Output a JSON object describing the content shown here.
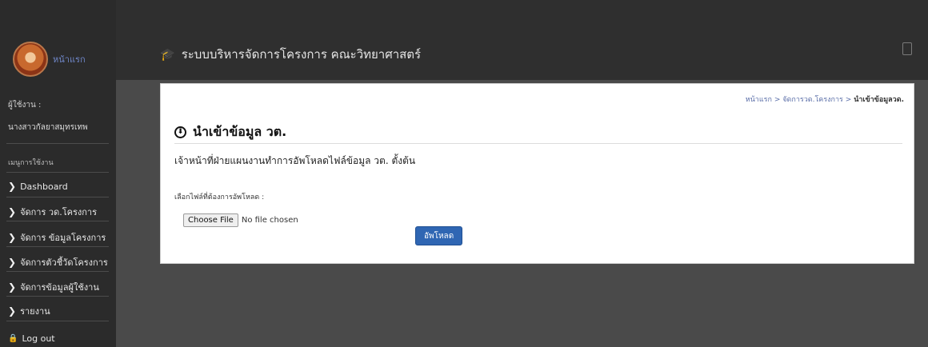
{
  "app": {
    "title": "ระบบบริหารจัดการโครงการ คณะวิทยาศาสตร์",
    "brand_name": "หน้าแรก"
  },
  "sidebar": {
    "user_label": "ผู้ใช้งาน :",
    "user_name": "นางสาวกัลยาสมุทรเทพ",
    "menu_heading": "เมนูการใช้งาน",
    "items": [
      {
        "label": "Dashboard"
      },
      {
        "label": "จัดการ วด.โครงการ"
      },
      {
        "label": "จัดการ ข้อมูลโครงการ"
      },
      {
        "label": "จัดการตัวชี้วัดโครงการ"
      },
      {
        "label": "จัดการข้อมูลผู้ใช้งาน"
      },
      {
        "label": "รายงาน"
      }
    ],
    "logout_label": "Log out"
  },
  "breadcrumb": {
    "home": "หน้าแรก",
    "sep": ">",
    "section": "จัดการวด.โครงการ",
    "current": "นำเข้าข้อมูลวด."
  },
  "panel": {
    "title": "นำเข้าข้อมูล วต.",
    "subtitle": "เจ้าหน้าที่ฝ่ายแผนงานทำการอัพโหลดไฟล์ข้อมูล วต. ตั้งต้น",
    "field_label": "เลือกไฟล์ที่ต้องการอัพโหลด :",
    "choose_file_label": "Choose File",
    "no_file_text": "No file chosen",
    "upload_label": "อัพโหลด"
  },
  "icons": {
    "app_title_icon": "graduation-cap-icon",
    "panel_icon": "download-circle-icon",
    "nav_icon": "chevron-right-icon",
    "logout_icon": "lock-icon"
  },
  "colors": {
    "sidebar_bg": "#2b2b2b",
    "topbar_bg": "#2f2f2f",
    "panel_bg": "#ffffff",
    "primary_button": "#2f66b3",
    "breadcrumb_link": "#5a6ea8"
  }
}
